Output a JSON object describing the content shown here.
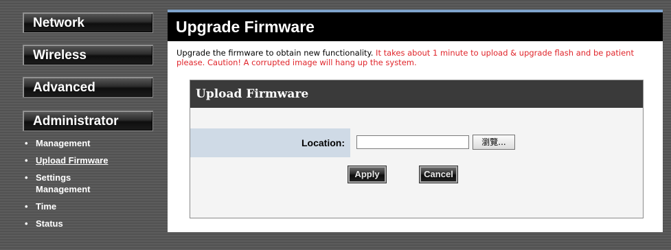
{
  "sidebar": {
    "nav": [
      {
        "label": "Network"
      },
      {
        "label": "Wireless"
      },
      {
        "label": "Advanced"
      },
      {
        "label": "Administrator"
      }
    ],
    "bullet": "•",
    "sub_items": [
      {
        "label": "Management"
      },
      {
        "label": "Upload Firmware"
      },
      {
        "label": "Settings Management"
      },
      {
        "label": "Time"
      },
      {
        "label": "Status"
      }
    ]
  },
  "main": {
    "title": "Upgrade Firmware",
    "description": "Upgrade the firmware to obtain new functionality.",
    "warning": "It takes about 1 minute to upload & upgrade flash and be patient please. Caution! A corrupted image will hang up the system.",
    "upload": {
      "title": "Upload Firmware",
      "location_label": "Location:",
      "location_value": "",
      "browse_label": "瀏覽...",
      "apply_label": "Apply",
      "cancel_label": "Cancel"
    }
  },
  "colors": {
    "warning_text": "#e0242a",
    "header_top_strip": "#7fa3cc",
    "label_cell_bg": "#cfdae6"
  }
}
